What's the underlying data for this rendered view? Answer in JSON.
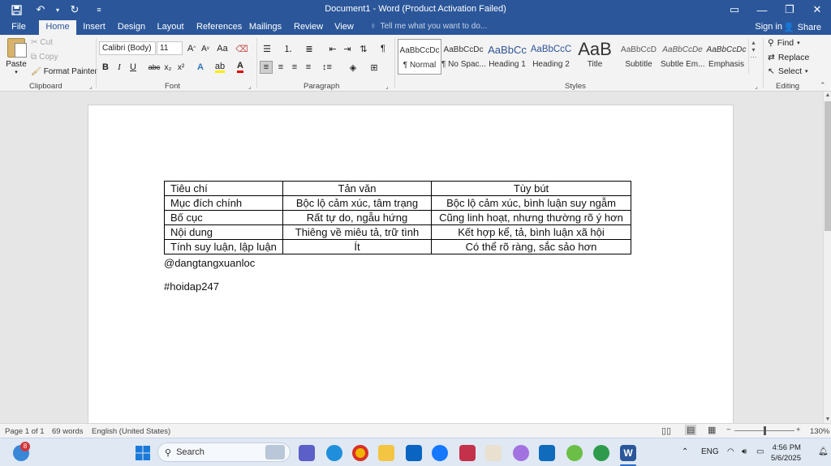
{
  "window": {
    "title": "Document1 - Word (Product Activation Failed)"
  },
  "tabs": [
    {
      "label": "File"
    },
    {
      "label": "Home"
    },
    {
      "label": "Insert"
    },
    {
      "label": "Design"
    },
    {
      "label": "Layout"
    },
    {
      "label": "References"
    },
    {
      "label": "Mailings"
    },
    {
      "label": "Review"
    },
    {
      "label": "View"
    }
  ],
  "tellme": "Tell me what you want to do...",
  "account": {
    "signin": "Sign in",
    "share": "Share"
  },
  "clipboard": {
    "paste": "Paste",
    "cut": "Cut",
    "copy": "Copy",
    "format_painter": "Format Painter",
    "label": "Clipboard"
  },
  "font": {
    "name": "Calibri (Body)",
    "size": "11",
    "label": "Font",
    "bold": "B",
    "italic": "I",
    "underline": "U",
    "strike": "abc",
    "subscript": "x₂",
    "superscript": "x²",
    "case": "Aa"
  },
  "paragraph": {
    "label": "Paragraph"
  },
  "styles": {
    "label": "Styles",
    "items": [
      {
        "preview": "AaBbCcDc",
        "name": "¶ Normal"
      },
      {
        "preview": "AaBbCcDc",
        "name": "¶ No Spac..."
      },
      {
        "preview": "AaBbCc",
        "name": "Heading 1"
      },
      {
        "preview": "AaBbCcC",
        "name": "Heading 2"
      },
      {
        "preview": "AaB",
        "name": "Title"
      },
      {
        "preview": "AaBbCcD",
        "name": "Subtitle"
      },
      {
        "preview": "AaBbCcDe",
        "name": "Subtle Em..."
      },
      {
        "preview": "AaBbCcDc",
        "name": "Emphasis"
      }
    ]
  },
  "editing": {
    "label": "Editing",
    "find": "Find",
    "replace": "Replace",
    "select": "Select"
  },
  "document": {
    "table": [
      [
        "Tiêu chí",
        "Tản văn",
        "Tùy bút"
      ],
      [
        "Mục đích chính",
        "Bộc lộ cảm xúc, tâm trạng",
        "Bộc lộ cảm xúc, bình luận suy ngẫm"
      ],
      [
        "Bố cục",
        "Rất tự do, ngẫu hứng",
        "Cũng linh hoạt, nhưng thường rõ ý hơn"
      ],
      [
        "Nội dung",
        "Thiêng về miêu tả, trữ tình",
        "Kết hợp kể, tả, bình luận xã hội"
      ],
      [
        "Tính suy luận, lập luận",
        "Ít",
        "Có thể rõ ràng, sắc sảo hơn"
      ]
    ],
    "line1": "@dangtangxuanloc",
    "line2": "#hoidap247"
  },
  "status": {
    "page": "Page 1 of 1",
    "words": "69 words",
    "language": "English (United States)",
    "zoom": "130%"
  },
  "taskbar": {
    "search": "Search",
    "badge": "8",
    "lang": "ENG",
    "time": "4:56 PM",
    "date": "5/6/2025"
  },
  "colors": {
    "word_blue": "#2b579a",
    "ribbon": "#f3f3f3",
    "canvas": "#e6e6e6"
  }
}
